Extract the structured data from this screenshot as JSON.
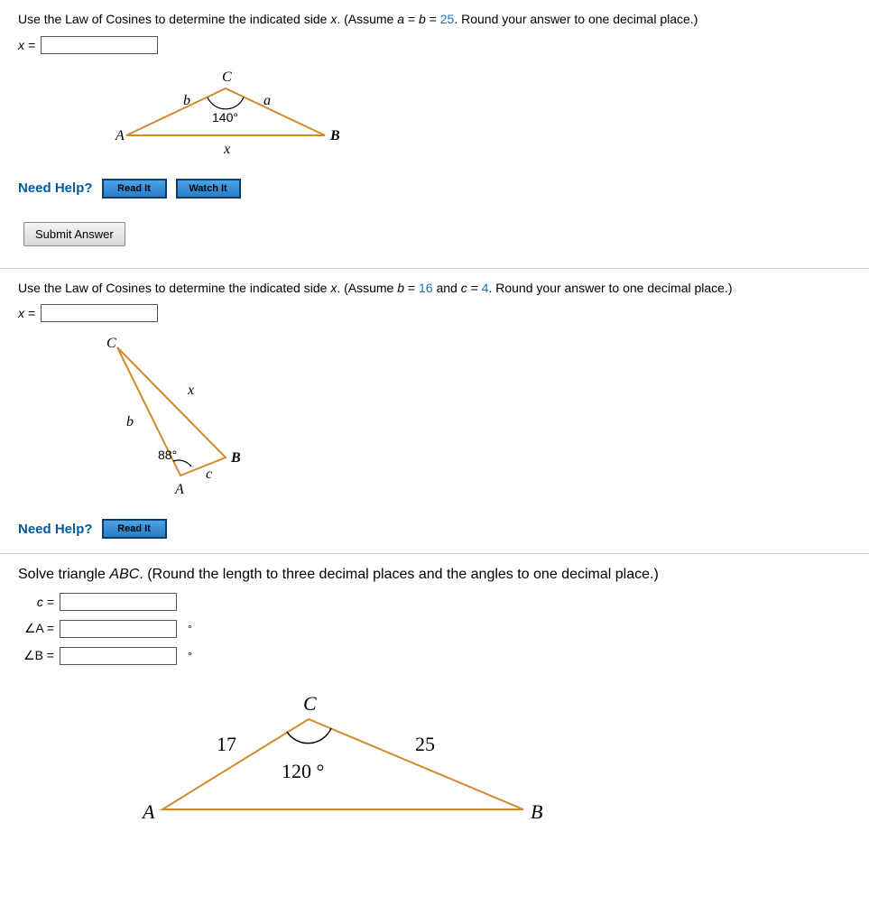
{
  "q1": {
    "prompt_pre": "Use the Law of Cosines to determine the indicated side ",
    "prompt_var": "x",
    "prompt_mid": ". (Assume ",
    "assume_a": "a",
    "eq1": " = ",
    "assume_b": "b",
    "eq2": " = ",
    "value": "25",
    "prompt_post": ". Round your answer to one decimal place.)",
    "answer_label": "x =",
    "figure": {
      "A": "A",
      "B": "B",
      "C": "C",
      "side_b": "b",
      "side_a": "a",
      "side_x": "x",
      "angle": "140°"
    },
    "help_label": "Need Help?",
    "read_it": "Read It",
    "watch_it": "Watch It",
    "submit": "Submit Answer"
  },
  "q2": {
    "prompt_pre": "Use the Law of Cosines to determine the indicated side ",
    "prompt_var": "x",
    "prompt_mid": ". (Assume ",
    "assume_b": "b",
    "eq1": " = ",
    "val_b": "16",
    "and": " and ",
    "assume_c": "c",
    "eq2": " = ",
    "val_c": "4",
    "prompt_post": ". Round your answer to one decimal place.)",
    "answer_label": "x =",
    "figure": {
      "A": "A",
      "B": "B",
      "C": "C",
      "side_b": "b",
      "side_x": "x",
      "side_c": "c",
      "angle": "88°"
    },
    "help_label": "Need Help?",
    "read_it": "Read It"
  },
  "q3": {
    "prompt_pre": "Solve triangle ",
    "tri": "ABC",
    "prompt_post": ". (Round the length to three decimal places and the angles to one decimal place.)",
    "c_label": "c =",
    "A_label": "∠A =",
    "B_label": "∠B =",
    "deg": "°",
    "figure": {
      "A": "A",
      "B": "B",
      "C": "C",
      "side_left": "17",
      "side_right": "25",
      "angle": "120 °"
    }
  }
}
